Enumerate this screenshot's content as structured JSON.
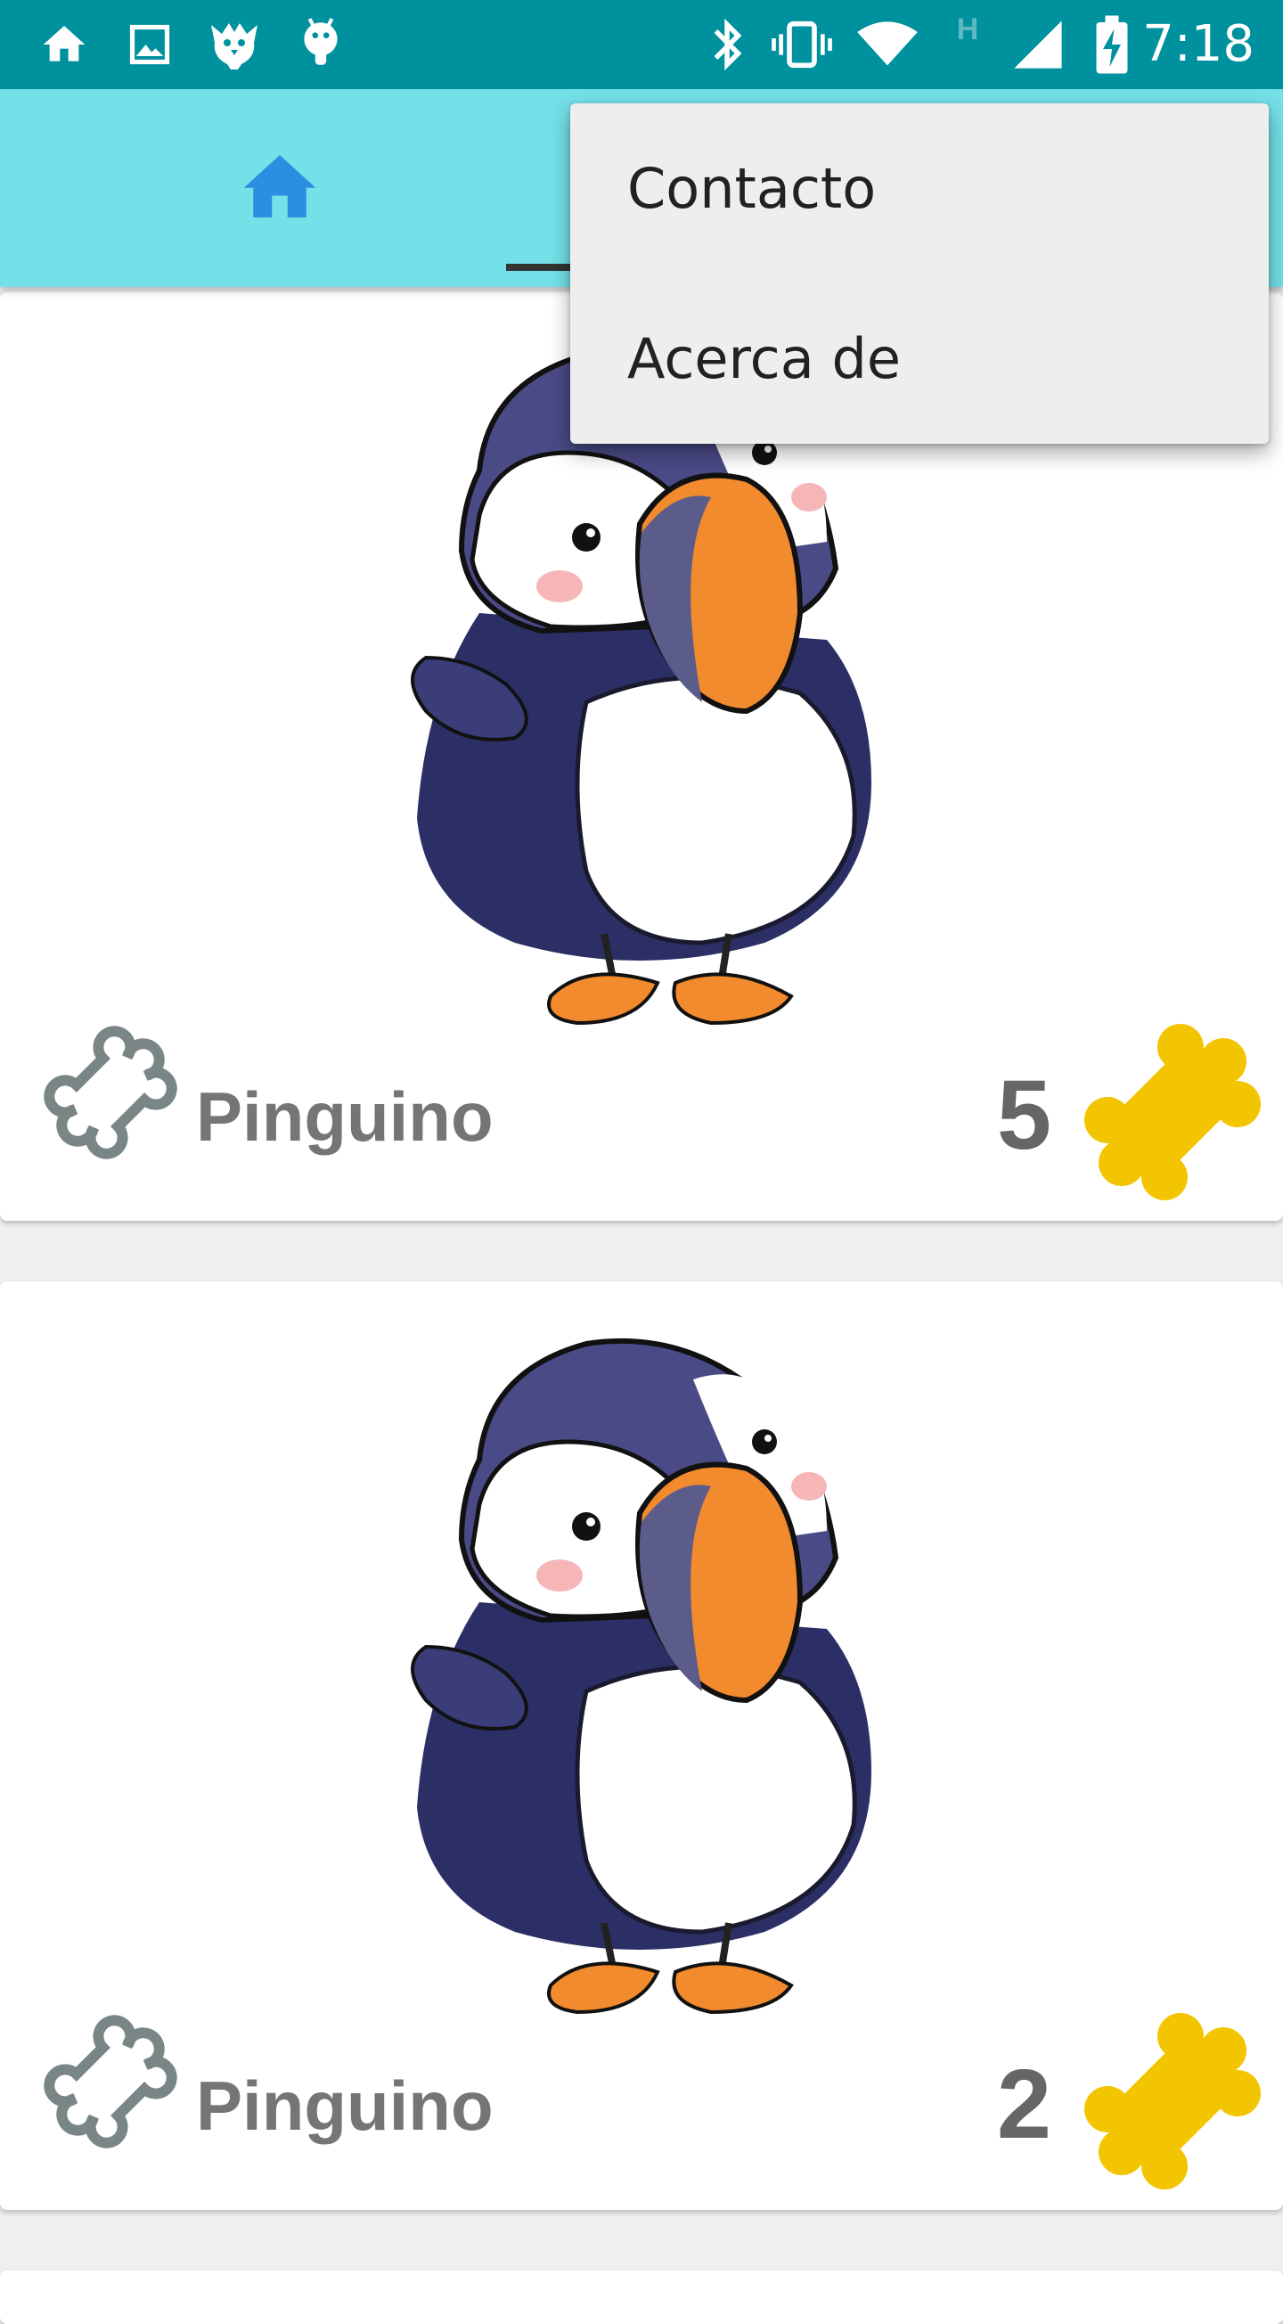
{
  "status_bar": {
    "time": "7:18",
    "left_icons": [
      "home-icon",
      "image-icon",
      "bird-icon",
      "android-icon"
    ],
    "right_icons": [
      "bluetooth-icon",
      "vibrate-icon",
      "wifi-icon",
      "h-network-icon",
      "signal-icon",
      "battery-charging-icon"
    ],
    "network_type": "H"
  },
  "app_bar": {
    "color": "#74e0e8",
    "tabs": [
      {
        "icon": "home-icon",
        "selected": false
      },
      {
        "icon": "",
        "selected": true
      }
    ]
  },
  "menu": {
    "items": [
      {
        "label": "Contacto"
      },
      {
        "label": "Acerca de"
      }
    ]
  },
  "cards": [
    {
      "name": "Pinguino",
      "count": "5",
      "image": "puffin-image",
      "rate_icon": "bone-outline-icon",
      "count_icon": "bone-icon"
    },
    {
      "name": "Pinguino",
      "count": "2",
      "image": "puffin-image",
      "rate_icon": "bone-outline-icon",
      "count_icon": "bone-icon"
    }
  ],
  "colors": {
    "status_bar": "#00919e",
    "accent_bone": "#f2c500",
    "outline_bone": "#7a8586",
    "home_icon": "#2a8fe0"
  }
}
